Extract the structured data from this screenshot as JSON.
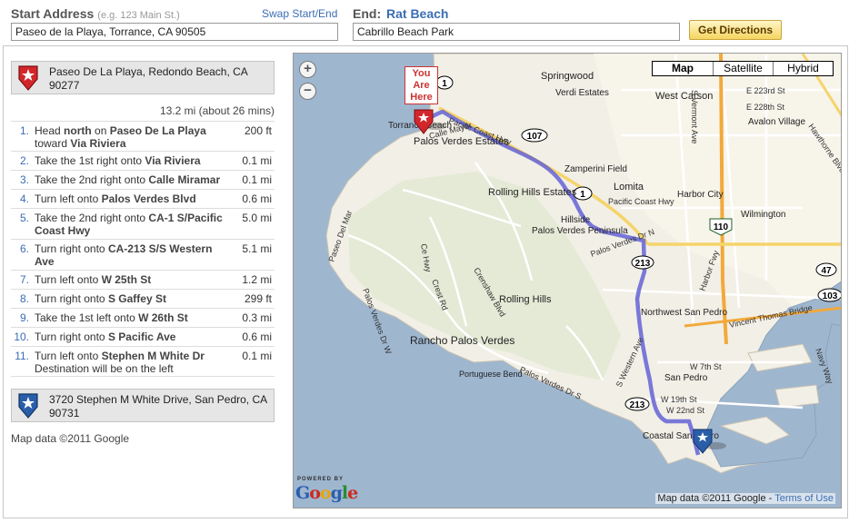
{
  "form": {
    "start_label": "Start Address",
    "start_example": "(e.g. 123 Main St.)",
    "swap_label": "Swap Start/End",
    "start_value": "Paseo de la Playa, Torrance, CA 90505",
    "end_label": "End:",
    "end_name": "Rat Beach",
    "end_value": "Cabrillo Beach Park",
    "directions_button": "Get Directions"
  },
  "directions": {
    "start_address": "Paseo De La Playa, Redondo Beach, CA 90277",
    "summary": "13.2 mi (about 26 mins)",
    "steps": [
      {
        "num": "1.",
        "pre": "Head ",
        "b1": "north",
        "mid": " on ",
        "b2": "Paseo De La Playa",
        "post": " toward ",
        "b3": "Via Riviera",
        "dist": "200 ft"
      },
      {
        "num": "2.",
        "pre": "Take the 1st right onto ",
        "b1": "Via Riviera",
        "dist": "0.1 mi"
      },
      {
        "num": "3.",
        "pre": "Take the 2nd right onto ",
        "b1": "Calle Miramar",
        "dist": "0.1 mi"
      },
      {
        "num": "4.",
        "pre": "Turn left onto ",
        "b1": "Palos Verdes Blvd",
        "dist": "0.6 mi"
      },
      {
        "num": "5.",
        "pre": "Take the 2nd right onto ",
        "b1": "CA-1 S/Pacific Coast Hwy",
        "dist": "5.0 mi"
      },
      {
        "num": "6.",
        "pre": "Turn right onto ",
        "b1": "CA-213 S/S Western Ave",
        "dist": "5.1 mi"
      },
      {
        "num": "7.",
        "pre": "Turn left onto ",
        "b1": "W 25th St",
        "dist": "1.2 mi"
      },
      {
        "num": "8.",
        "pre": "Turn right onto ",
        "b1": "S Gaffey St",
        "dist": "299 ft"
      },
      {
        "num": "9.",
        "pre": "Take the 1st left onto ",
        "b1": "W 26th St",
        "dist": "0.3 mi"
      },
      {
        "num": "10.",
        "pre": "Turn right onto ",
        "b1": "S Pacific Ave",
        "dist": "0.6 mi"
      },
      {
        "num": "11.",
        "pre": "Turn left onto ",
        "b1": "Stephen M White Dr",
        "note": "Destination will be on the left",
        "dist": "0.1 mi"
      }
    ],
    "end_address": "3720 Stephen M White Drive, San Pedro, CA 90731",
    "credit": "Map data ©2011 Google"
  },
  "map": {
    "map_types": [
      "Map",
      "Satellite",
      "Hybrid"
    ],
    "you_are_here": "You Are Here",
    "powered_by": "POWERED BY",
    "logo_letters": [
      "G",
      "o",
      "o",
      "g",
      "l",
      "e"
    ],
    "credit_text": "Map data ©2011 Google -",
    "terms_link": "Terms of Use",
    "places": [
      {
        "name": "Springwood"
      },
      {
        "name": "Verdi Estates"
      },
      {
        "name": "West Carson"
      },
      {
        "name": "Torrance Beach"
      },
      {
        "name": "Zamperini Field"
      },
      {
        "name": "Palos Verdes Estates"
      },
      {
        "name": "Lomita"
      },
      {
        "name": "Rolling Hills Estates"
      },
      {
        "name": "Harbor City"
      },
      {
        "name": "Wilmington"
      },
      {
        "name": "Hillside"
      },
      {
        "name": "Palos Verdes Peninsula"
      },
      {
        "name": "Rolling Hills"
      },
      {
        "name": "Northwest San Pedro"
      },
      {
        "name": "Rancho Palos Verdes"
      },
      {
        "name": "Portuguese Bend"
      },
      {
        "name": "San Pedro"
      },
      {
        "name": "Coastal San Pedro"
      },
      {
        "name": "Avalon Village"
      }
    ],
    "roads": [
      {
        "name": "Pacific Coast Hwy"
      },
      {
        "name": "Calle Mayor"
      },
      {
        "name": "Pacific Coast Hwy"
      },
      {
        "name": "Paseo Del Mar"
      },
      {
        "name": "Crenshaw Blvd"
      },
      {
        "name": "Palos Verdes Dr N"
      },
      {
        "name": "Palos Verdes Dr W"
      },
      {
        "name": "Palos Verdes Dr S"
      },
      {
        "name": "Harbor Fwy"
      },
      {
        "name": "Vincent Thomas Bridge"
      },
      {
        "name": "Navy Way"
      },
      {
        "name": "S Western Ave"
      },
      {
        "name": "W 7th St"
      },
      {
        "name": "W 19th St"
      },
      {
        "name": "W 22nd St"
      },
      {
        "name": "S Vermont Ave"
      },
      {
        "name": "E 223rd St"
      },
      {
        "name": "E 228th St"
      },
      {
        "name": "Hawthorne Blvd"
      },
      {
        "name": "Ce Hwy"
      },
      {
        "name": "Crest Rd"
      }
    ],
    "shields": [
      {
        "label": "1"
      },
      {
        "label": "107"
      },
      {
        "label": "1"
      },
      {
        "label": "213"
      },
      {
        "label": "213"
      },
      {
        "label": "110"
      },
      {
        "label": "47"
      },
      {
        "label": "103"
      }
    ]
  }
}
